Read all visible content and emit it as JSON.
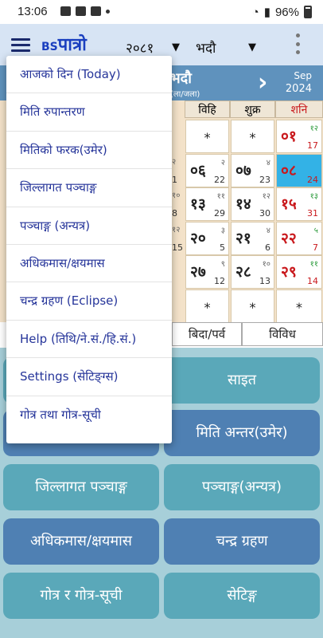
{
  "status": {
    "time": "13:06",
    "battery": "96%"
  },
  "app": {
    "brand_prefix": "BS",
    "brand_name": "पात्रो",
    "year": "२०८१",
    "month": "भदौ",
    "dropdown_glyph": "▼"
  },
  "calendar_header": {
    "month_name": "भदौ",
    "month_sub": "(ला/जला)",
    "next_glyph": "›",
    "eng_month": "Sep",
    "eng_year": "2024"
  },
  "weekdays": [
    "विहि",
    "शुक्र",
    "शनि"
  ],
  "cells": [
    {
      "n": "",
      "star": "*"
    },
    {
      "n": "",
      "star": "*"
    },
    {
      "n": "०१",
      "t": "१२",
      "e": "17",
      "sat": true
    },
    {
      "n": "०६",
      "t": "२",
      "e": "22"
    },
    {
      "n": "०७",
      "t": "४",
      "e": "23"
    },
    {
      "n": "०८",
      "t": "",
      "e": "24",
      "sat": true,
      "today": true
    },
    {
      "n": "१३",
      "t": "११",
      "e": "29"
    },
    {
      "n": "१४",
      "t": "१२",
      "e": "30"
    },
    {
      "n": "१५",
      "t": "१३",
      "e": "31",
      "sat": true
    },
    {
      "n": "२०",
      "t": "३",
      "e": "5"
    },
    {
      "n": "२१",
      "t": "४",
      "e": "6"
    },
    {
      "n": "२२",
      "t": "५",
      "e": "7",
      "sat": true
    },
    {
      "n": "२७",
      "t": "९",
      "e": "12"
    },
    {
      "n": "२८",
      "t": "१०",
      "e": "13"
    },
    {
      "n": "२९",
      "t": "११",
      "e": "14",
      "sat": true
    },
    {
      "n": "",
      "star": "*"
    },
    {
      "n": "",
      "star": "*"
    },
    {
      "n": "",
      "star": "*"
    }
  ],
  "left_partial": [
    "२",
    "१०",
    "१२"
  ],
  "left_partial_e": [
    "1",
    "8",
    "15"
  ],
  "tabs": {
    "bida": "बिदा/पर्व",
    "vividh": "विविध"
  },
  "buttons": {
    "site": "साइत",
    "umer": "मिति अन्तर(उमेर)",
    "jillagat": "जिल्लागत पञ्चाङ्ग",
    "panchang": "पञ्चाङ्ग(अन्यत्र)",
    "adhikmas": "अधिकमास/क्षयमास",
    "chandra": "चन्द्र ग्रहण",
    "gotra": "गोत्र र गोत्र-सूची",
    "settings": "सेटिङ्ग"
  },
  "drawer": {
    "items": [
      "आजको दिन (Today)",
      "मिति रुपान्तरण",
      "मितिको फरक(उमेर)",
      "जिल्लागत पञ्चाङ्ग",
      "पञ्चाङ्ग (अन्यत्र)",
      "अधिकमास/क्षयमास",
      "चन्द्र ग्रहण (Eclipse)",
      "Help (तिथि/ने.सं./हि.सं.)",
      "Settings (सेटिङ्ग्स)",
      "गोत्र तथा गोत्र-सूची"
    ]
  },
  "colors": {
    "appbar": "#d7e4f4",
    "header": "#5f92bd",
    "saturday": "#c9191d",
    "today": "#33b2e6",
    "menu_text": "#26359a"
  }
}
